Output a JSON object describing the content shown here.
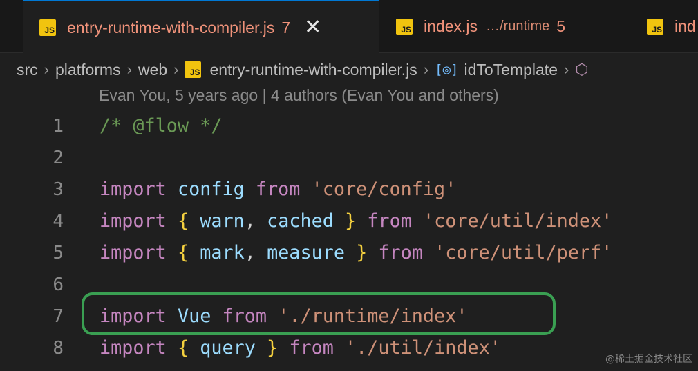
{
  "tabs": [
    {
      "name": "entry-runtime-with-compiler.js",
      "hint": "",
      "count": "7",
      "close": "✕",
      "active": true
    },
    {
      "name": "index.js",
      "hint": "…/runtime",
      "count": "5",
      "active": false
    },
    {
      "name": "ind",
      "hint": "",
      "count": "",
      "active": false
    }
  ],
  "file_badge": "JS",
  "breadcrumb": {
    "items": [
      "src",
      "platforms",
      "web",
      "entry-runtime-with-compiler.js",
      "idToTemplate"
    ],
    "separator": "›"
  },
  "blame": "Evan You, 5 years ago | 4 authors (Evan You and others)",
  "code": {
    "lines": [
      {
        "n": "1",
        "tokens": [
          {
            "t": "/* @flow */",
            "c": "comment"
          }
        ]
      },
      {
        "n": "2",
        "tokens": []
      },
      {
        "n": "3",
        "tokens": [
          {
            "t": "import",
            "c": "kw"
          },
          {
            "t": " ",
            "c": "punc"
          },
          {
            "t": "config",
            "c": "id"
          },
          {
            "t": " ",
            "c": "punc"
          },
          {
            "t": "from",
            "c": "kw"
          },
          {
            "t": " ",
            "c": "punc"
          },
          {
            "t": "'core/config'",
            "c": "str"
          }
        ]
      },
      {
        "n": "4",
        "tokens": [
          {
            "t": "import",
            "c": "kw"
          },
          {
            "t": " ",
            "c": "punc"
          },
          {
            "t": "{",
            "c": "brace"
          },
          {
            "t": " ",
            "c": "punc"
          },
          {
            "t": "warn",
            "c": "id"
          },
          {
            "t": ", ",
            "c": "punc"
          },
          {
            "t": "cached",
            "c": "id"
          },
          {
            "t": " ",
            "c": "punc"
          },
          {
            "t": "}",
            "c": "brace"
          },
          {
            "t": " ",
            "c": "punc"
          },
          {
            "t": "from",
            "c": "kw"
          },
          {
            "t": " ",
            "c": "punc"
          },
          {
            "t": "'core/util/index'",
            "c": "str"
          }
        ]
      },
      {
        "n": "5",
        "tokens": [
          {
            "t": "import",
            "c": "kw"
          },
          {
            "t": " ",
            "c": "punc"
          },
          {
            "t": "{",
            "c": "brace"
          },
          {
            "t": " ",
            "c": "punc"
          },
          {
            "t": "mark",
            "c": "id"
          },
          {
            "t": ", ",
            "c": "punc"
          },
          {
            "t": "measure",
            "c": "id"
          },
          {
            "t": " ",
            "c": "punc"
          },
          {
            "t": "}",
            "c": "brace"
          },
          {
            "t": " ",
            "c": "punc"
          },
          {
            "t": "from",
            "c": "kw"
          },
          {
            "t": " ",
            "c": "punc"
          },
          {
            "t": "'core/util/perf'",
            "c": "str"
          }
        ]
      },
      {
        "n": "6",
        "tokens": []
      },
      {
        "n": "7",
        "tokens": [
          {
            "t": "import",
            "c": "kw"
          },
          {
            "t": " ",
            "c": "punc"
          },
          {
            "t": "Vue",
            "c": "id"
          },
          {
            "t": " ",
            "c": "punc"
          },
          {
            "t": "from",
            "c": "kw"
          },
          {
            "t": " ",
            "c": "punc"
          },
          {
            "t": "'./runtime/index'",
            "c": "str"
          }
        ]
      },
      {
        "n": "8",
        "tokens": [
          {
            "t": "import",
            "c": "kw"
          },
          {
            "t": " ",
            "c": "punc"
          },
          {
            "t": "{",
            "c": "brace"
          },
          {
            "t": " ",
            "c": "punc"
          },
          {
            "t": "query",
            "c": "id"
          },
          {
            "t": " ",
            "c": "punc"
          },
          {
            "t": "}",
            "c": "brace"
          },
          {
            "t": " ",
            "c": "punc"
          },
          {
            "t": "from",
            "c": "kw"
          },
          {
            "t": " ",
            "c": "punc"
          },
          {
            "t": "'./util/index'",
            "c": "str"
          }
        ]
      }
    ]
  },
  "watermark": "@稀土掘金技术社区",
  "colors": {
    "editor_bg": "#1f1f1f",
    "tab_error": "#f0927a",
    "keyword": "#c586c0",
    "identifier": "#9cdcfe",
    "string": "#ce9178",
    "comment": "#6a9955",
    "brace": "#f4d03f",
    "highlight": "#3a9f52"
  }
}
